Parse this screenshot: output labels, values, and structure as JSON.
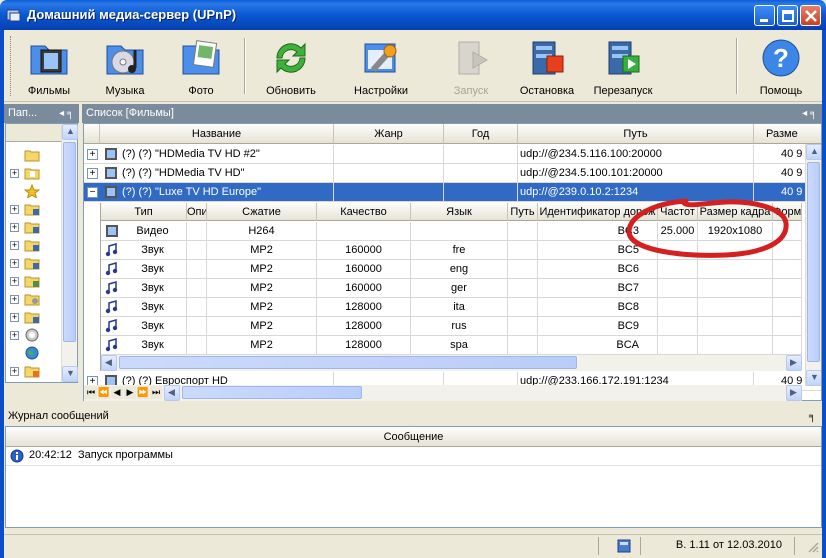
{
  "window": {
    "title": "Домашний медиа-сервер (UPnP)"
  },
  "toolbar": {
    "items": [
      {
        "label": "Фильмы",
        "enabled": true
      },
      {
        "label": "Музыка",
        "enabled": true
      },
      {
        "label": "Фото",
        "enabled": true
      },
      {
        "label": "Обновить",
        "enabled": true
      },
      {
        "label": "Настройки",
        "enabled": true
      },
      {
        "label": "Запуск",
        "enabled": false
      },
      {
        "label": "Остановка",
        "enabled": true
      },
      {
        "label": "Перезапуск",
        "enabled": true
      },
      {
        "label": "Помощь",
        "enabled": true
      }
    ]
  },
  "left_panel": {
    "title": "Пап..."
  },
  "main_panel": {
    "title": "Список [Фильмы]"
  },
  "grid": {
    "columns": [
      "Название",
      "Жанр",
      "Год",
      "Путь",
      "Разме"
    ],
    "rows": [
      {
        "name": "(?) (?)  \"HDMedia TV HD #2\"",
        "path": "udp://@234.5.116.100:20000",
        "size": "40 9",
        "expand": "+"
      },
      {
        "name": "(?) (?)  \"HDMedia TV HD\"",
        "path": "udp://@234.5.100.101:20000",
        "size": "40 9",
        "expand": "+"
      },
      {
        "name": "(?) (?)  \"Luxe TV HD Europe\"",
        "path": "udp://@239.0.10.2:1234",
        "size": "40 9",
        "expand": "−"
      },
      {
        "name": "(?) (?)  Евроспорт HD",
        "path": "udp://@233.166.172.191:1234",
        "size": "40 9",
        "expand": "+"
      }
    ]
  },
  "subgrid": {
    "columns": [
      "Тип",
      "Опи",
      "Сжатие",
      "Качество",
      "Язык",
      "Путь",
      "Идентификатор дорож",
      "Частот",
      "Размер кадра",
      "Форм"
    ],
    "rows": [
      {
        "type": "Видео",
        "codec": "H264",
        "quality": "",
        "lang": "",
        "id": "BC3",
        "fps": "25.000",
        "frame": "1920x1080",
        "kind": "video"
      },
      {
        "type": "Звук",
        "codec": "MP2",
        "quality": "160000",
        "lang": "fre",
        "id": "BC5",
        "fps": "",
        "frame": "",
        "kind": "audio"
      },
      {
        "type": "Звук",
        "codec": "MP2",
        "quality": "160000",
        "lang": "eng",
        "id": "BC6",
        "fps": "",
        "frame": "",
        "kind": "audio"
      },
      {
        "type": "Звук",
        "codec": "MP2",
        "quality": "160000",
        "lang": "ger",
        "id": "BC7",
        "fps": "",
        "frame": "",
        "kind": "audio"
      },
      {
        "type": "Звук",
        "codec": "MP2",
        "quality": "128000",
        "lang": "ita",
        "id": "BC8",
        "fps": "",
        "frame": "",
        "kind": "audio"
      },
      {
        "type": "Звук",
        "codec": "MP2",
        "quality": "128000",
        "lang": "rus",
        "id": "BC9",
        "fps": "",
        "frame": "",
        "kind": "audio"
      },
      {
        "type": "Звук",
        "codec": "MP2",
        "quality": "128000",
        "lang": "spa",
        "id": "BCA",
        "fps": "",
        "frame": "",
        "kind": "audio"
      }
    ]
  },
  "log": {
    "title": "Журнал сообщений",
    "column": "Сообщение",
    "entries": [
      {
        "time": "20:42:12",
        "text": "Запуск программы"
      }
    ]
  },
  "status": {
    "version": "В. 1.11 от 12.03.2010"
  },
  "colors": {
    "accent": "#316ac5",
    "titlebar": "#0a58d0",
    "highlight_mark": "#d42020"
  }
}
